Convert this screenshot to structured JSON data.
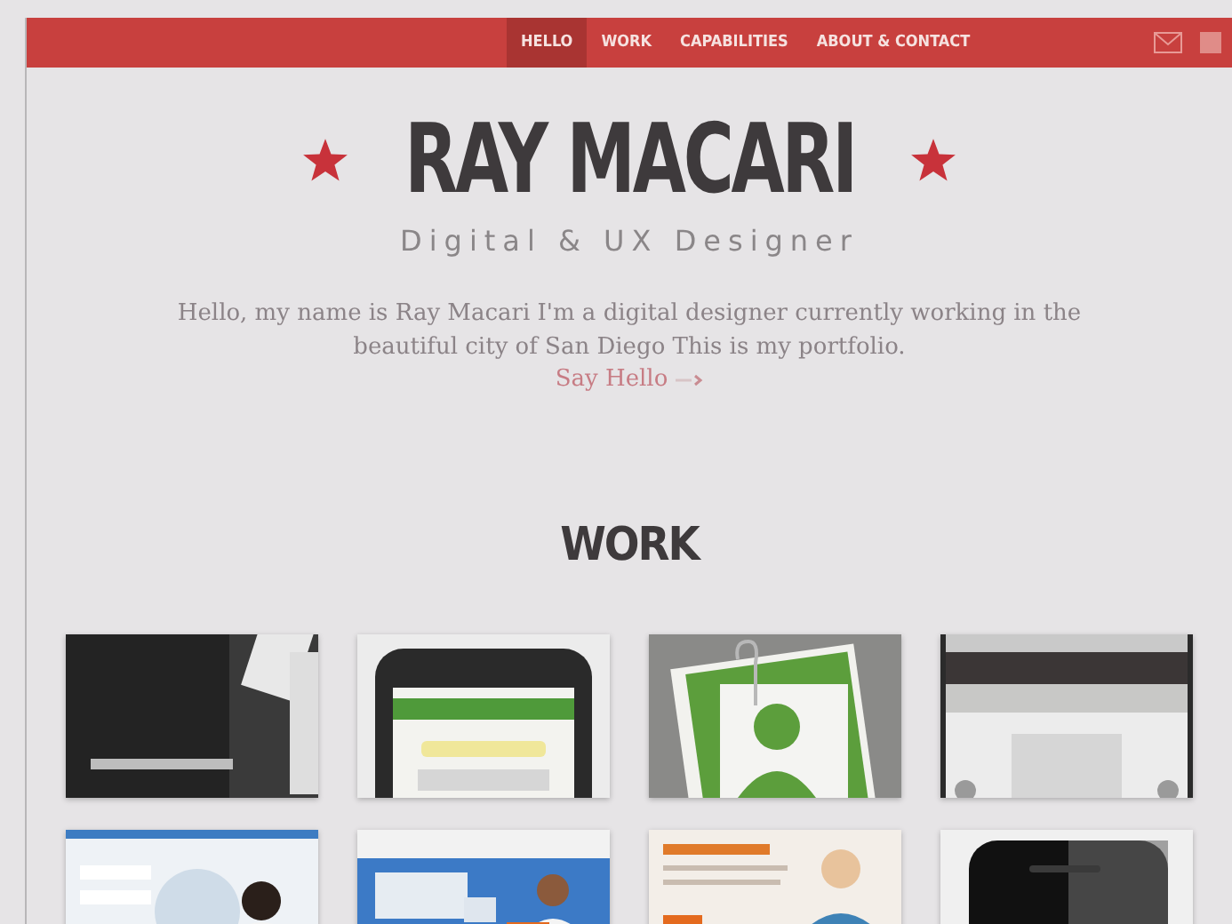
{
  "nav": {
    "items": [
      {
        "label": "HELLO",
        "selected": true
      },
      {
        "label": "WORK",
        "selected": false
      },
      {
        "label": "CAPABILITIES",
        "selected": false
      },
      {
        "label": "ABOUT & CONTACT",
        "selected": false
      }
    ]
  },
  "hero": {
    "title": "RAY MACARI",
    "subtitle": "Digital & UX Designer",
    "intro": "Hello, my name is Ray Macari  I'm a digital designer currently working in the beautiful city of San Diego  This is my portfolio.",
    "link": "Say Hello"
  },
  "work": {
    "heading": "WORK"
  }
}
